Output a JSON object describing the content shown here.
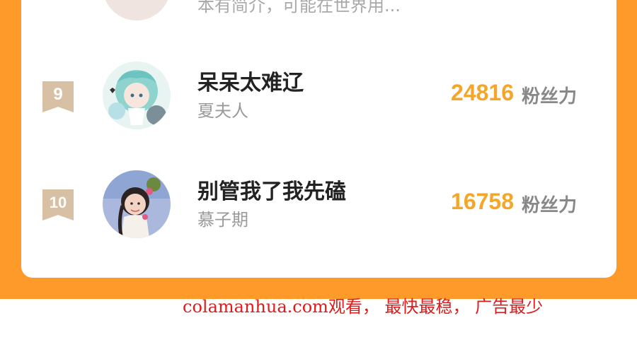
{
  "ranking": {
    "rows": [
      {
        "rank": "",
        "name": "",
        "description": "本有简介，可能在世界用...",
        "score": "",
        "unit": ""
      },
      {
        "rank": "9",
        "name": "呆呆太难辽",
        "description": "夏夫人",
        "score": "24816",
        "unit": "粉丝力"
      },
      {
        "rank": "10",
        "name": "别管我了我先磕",
        "description": "慕子期",
        "score": "16758",
        "unit": "粉丝力"
      }
    ]
  },
  "watermark": "colamanhua.com观看， 最快最稳， 广告最少",
  "colors": {
    "background_orange": "#fe9a2a",
    "score_orange": "#f3a62a",
    "badge_tan": "#d8c0a4",
    "watermark_red": "#e01b1b"
  }
}
